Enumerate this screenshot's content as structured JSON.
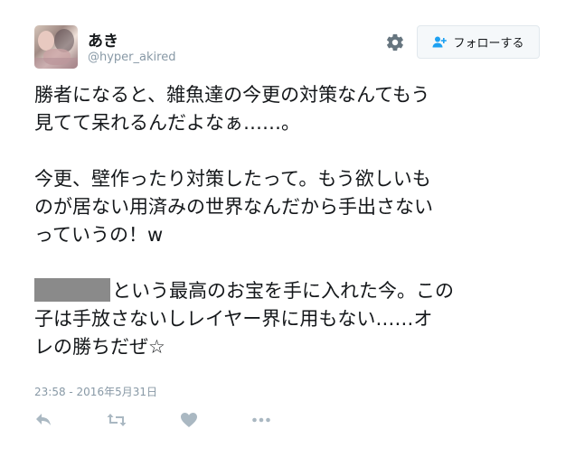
{
  "user": {
    "name": "あき",
    "handle": "@hyper_akired"
  },
  "follow_button": {
    "label": "フォローする",
    "icon": "add-user-icon"
  },
  "settings_icon": "gear-icon",
  "tweet": {
    "paragraph1": {
      "line1": "勝者になると、雑魚達の今更の対策なんてもう",
      "line2": "見てて呆れるんだよなぁ……。"
    },
    "paragraph2": {
      "line1": "今更、壁作ったり対策したって。もう欲しいも",
      "line2": "のが居ない用済みの世界なんだから手出さない",
      "line3": "っていうの！w"
    },
    "paragraph3": {
      "line1_after_redaction": "という最高のお宝を手に入れた今。この",
      "line2": "子は手放さないしレイヤー界に用もない……オ",
      "line3": "レの勝ちだぜ☆"
    }
  },
  "timestamp": "23:58 - 2016年5月31日",
  "actions": [
    "reply-icon",
    "retweet-icon",
    "like-icon",
    "more-icon"
  ],
  "colors": {
    "text": "#14171a",
    "muted": "#8899a6",
    "icon": "#aab8c2",
    "accent": "#1da1f2",
    "button_bg": "#f5f8fa",
    "button_border": "#e1e8ed",
    "redaction": "#8a8a8a"
  }
}
